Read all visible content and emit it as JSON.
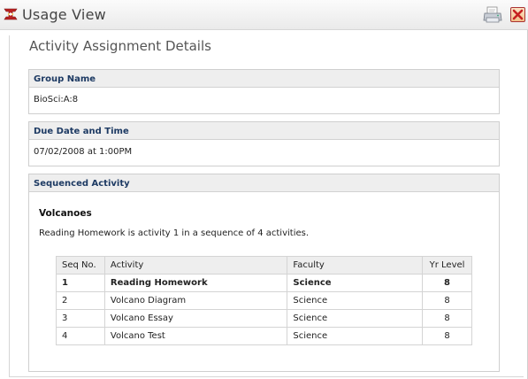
{
  "window": {
    "title": "Usage View",
    "icons": {
      "app": "app-logo-icon",
      "print": "printer-icon",
      "close": "close-icon"
    }
  },
  "page": {
    "heading": "Activity Assignment Details"
  },
  "group": {
    "label": "Group Name",
    "value": "BioSci:A:8"
  },
  "due": {
    "label": "Due Date and Time",
    "value": "07/02/2008 at 1:00PM"
  },
  "sequence": {
    "label": "Sequenced Activity",
    "title": "Volcanoes",
    "description": "Reading Homework is activity 1 in a sequence of 4 activities.",
    "columns": [
      "Seq No.",
      "Activity",
      "Faculty",
      "Yr Level"
    ],
    "rows": [
      {
        "seq": "1",
        "activity": "Reading Homework",
        "faculty": "Science",
        "level": "8",
        "current": true
      },
      {
        "seq": "2",
        "activity": "Volcano Diagram",
        "faculty": "Science",
        "level": "8",
        "current": false
      },
      {
        "seq": "3",
        "activity": "Volcano Essay",
        "faculty": "Science",
        "level": "8",
        "current": false
      },
      {
        "seq": "4",
        "activity": "Volcano Test",
        "faculty": "Science",
        "level": "8",
        "current": false
      }
    ]
  },
  "colors": {
    "panel_heading_text": "#1d3a63",
    "close_accent": "#c62020"
  }
}
